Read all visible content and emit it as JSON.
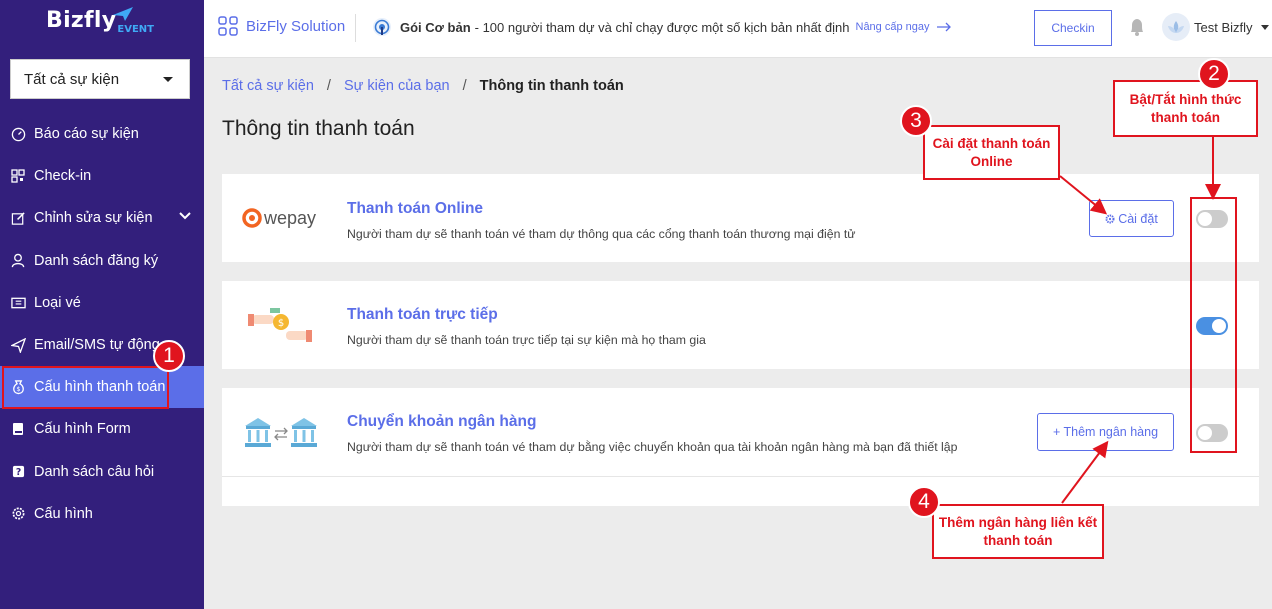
{
  "sidebar": {
    "logo_main": "Bizfly",
    "logo_sub": "EVENT",
    "event_select": "Tất cả sự kiện",
    "items": [
      {
        "label": "Báo cáo sự kiện",
        "icon": "gauge-icon"
      },
      {
        "label": "Check-in",
        "icon": "qr-icon"
      },
      {
        "label": "Chỉnh sửa sự kiện",
        "icon": "edit-icon"
      },
      {
        "label": "Danh sách đăng ký",
        "icon": "user-icon"
      },
      {
        "label": "Loại vé",
        "icon": "ticket-icon"
      },
      {
        "label": "Email/SMS tự động",
        "icon": "send-icon"
      },
      {
        "label": "Cấu hình thanh toán",
        "icon": "money-bag-icon"
      },
      {
        "label": "Cấu hình Form",
        "icon": "book-icon"
      },
      {
        "label": "Danh sách câu hỏi",
        "icon": "question-icon"
      },
      {
        "label": "Cấu hình",
        "icon": "gear-icon"
      }
    ]
  },
  "header": {
    "brand": "BizFly Solution",
    "plan_name": "Gói Cơ bản",
    "plan_desc": "- 100 người tham dự và chỉ chạy được một số kịch bản nhất định",
    "upgrade": "Nâng cấp ngay",
    "checkin": "Checkin",
    "user": "Test Bizfly"
  },
  "breadcrumb": {
    "b1": "Tất cả sự kiện",
    "b2": "Sự kiện của bạn",
    "b3": "Thông tin thanh toán",
    "sep": "/"
  },
  "page_title": "Thông tin thanh toán",
  "methods": [
    {
      "name": "Thanh toán Online",
      "desc": "Người tham dự sẽ thanh toán vé tham dự thông qua các cổng thanh toán thương mại điện tử",
      "button": "Cài đặt",
      "enabled": false,
      "logo": "wepay"
    },
    {
      "name": "Thanh toán trực tiếp",
      "desc": "Người tham dự sẽ thanh toán trực tiếp tại sự kiện mà họ tham gia",
      "enabled": true
    },
    {
      "name": "Chuyển khoản ngân hàng",
      "desc": "Người tham dự sẽ thanh toán vé tham dự bằng việc chuyển khoản qua tài khoản ngân hàng mà bạn đã thiết lập",
      "button": "+ Thêm ngân hàng",
      "enabled": false
    }
  ],
  "annotations": {
    "n1": "1",
    "n2": "2",
    "n3": "3",
    "n4": "4",
    "c2": "Bật/Tắt hình thức thanh toán",
    "c3": "Cài đặt thanh toán Online",
    "c4": "Thêm ngân hàng liên kết thanh toán"
  },
  "colors": {
    "sidebar": "#331f7c",
    "accent": "#5b6ee8",
    "annotation": "#e0141e"
  }
}
